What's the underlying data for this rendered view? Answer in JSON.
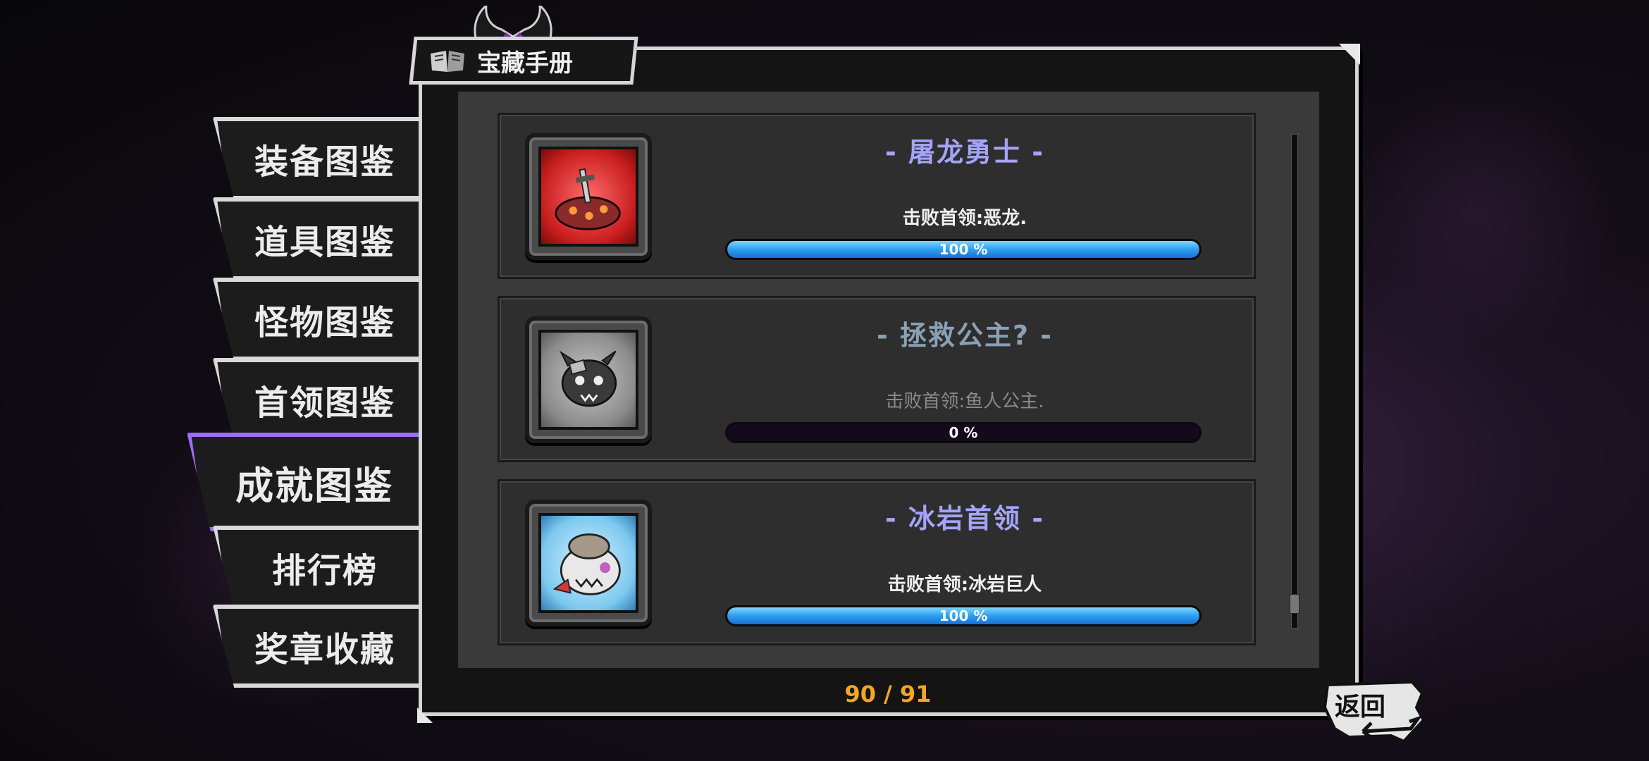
{
  "header": {
    "title": "宝藏手册",
    "book_icon": "book-icon",
    "horns_icon": "demon-horns-icon"
  },
  "tabs": [
    {
      "label": "装备图鉴",
      "active": false
    },
    {
      "label": "道具图鉴",
      "active": false
    },
    {
      "label": "怪物图鉴",
      "active": false
    },
    {
      "label": "首领图鉴",
      "active": false
    },
    {
      "label": "成就图鉴",
      "active": true
    },
    {
      "label": "排行榜",
      "active": false
    },
    {
      "label": "奖章收藏",
      "active": false
    }
  ],
  "achievements": [
    {
      "title": "- 屠龙勇士 -",
      "desc": "击败首领:恶龙.",
      "progress_label": "100 %",
      "progress": 1.0,
      "completed": true,
      "icon": "dragon-boss-icon",
      "icon_bg": "#d83a3a"
    },
    {
      "title": "- 拯救公主? -",
      "desc": "击败首领:鱼人公主.",
      "progress_label": "0 %",
      "progress": 0.0,
      "completed": false,
      "icon": "fish-princess-boss-icon",
      "icon_bg": "#9a9a9a"
    },
    {
      "title": "- 冰岩首领 -",
      "desc": "击败首领:冰岩巨人",
      "progress_label": "100 %",
      "progress": 1.0,
      "completed": true,
      "icon": "ice-golem-boss-icon",
      "icon_bg": "#7cc8ef"
    }
  ],
  "counter": "90 / 91",
  "back_button": {
    "label": "返回",
    "icon": "return-arrow-icon"
  },
  "colors": {
    "accent": "#a26bff",
    "title_completed": "#a4a4ff",
    "title_incomplete": "#8aa0b3",
    "counter": "#f5a623",
    "progress": "#2c9ff0"
  },
  "scroll": {
    "position_fraction": 0.97
  }
}
